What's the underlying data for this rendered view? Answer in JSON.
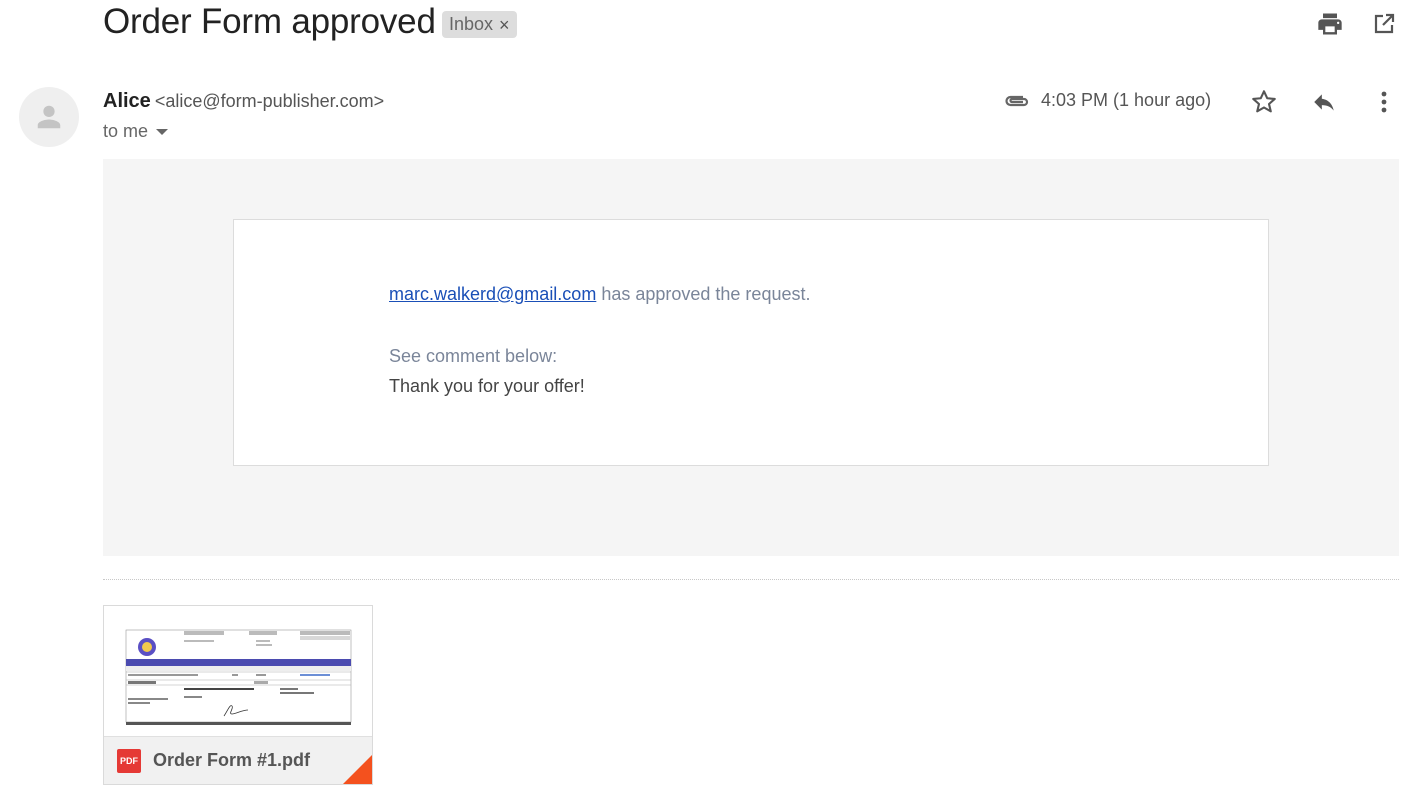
{
  "email": {
    "subject": "Order Form approved",
    "label_chip": "Inbox",
    "label_remove": "×",
    "sender_name": "Alice",
    "sender_email": "<alice@form-publisher.com>",
    "recipient": "to me",
    "timestamp": "4:03 PM (1 hour ago)"
  },
  "body": {
    "approver_email": "marc.walkerd@gmail.com",
    "approval_text": " has approved the request.",
    "comment_label": "See comment below:",
    "comment_text": "Thank you for your offer!"
  },
  "attachment": {
    "badge": "PDF",
    "file_name": "Order Form #1.pdf"
  },
  "colors": {
    "chip_bg": "#dddddd",
    "panel_bg": "#f5f5f5",
    "link": "#1a4fb7",
    "pdf_red": "#e53935",
    "corner_fold": "#f4511e"
  },
  "icons": {
    "print": "print-icon",
    "popout": "open-in-new-window-icon",
    "avatar": "person-icon",
    "attachment": "paperclip-icon",
    "star": "star-icon",
    "reply": "reply-icon",
    "more": "more-vertical-icon",
    "dropdown": "caret-down-icon"
  }
}
